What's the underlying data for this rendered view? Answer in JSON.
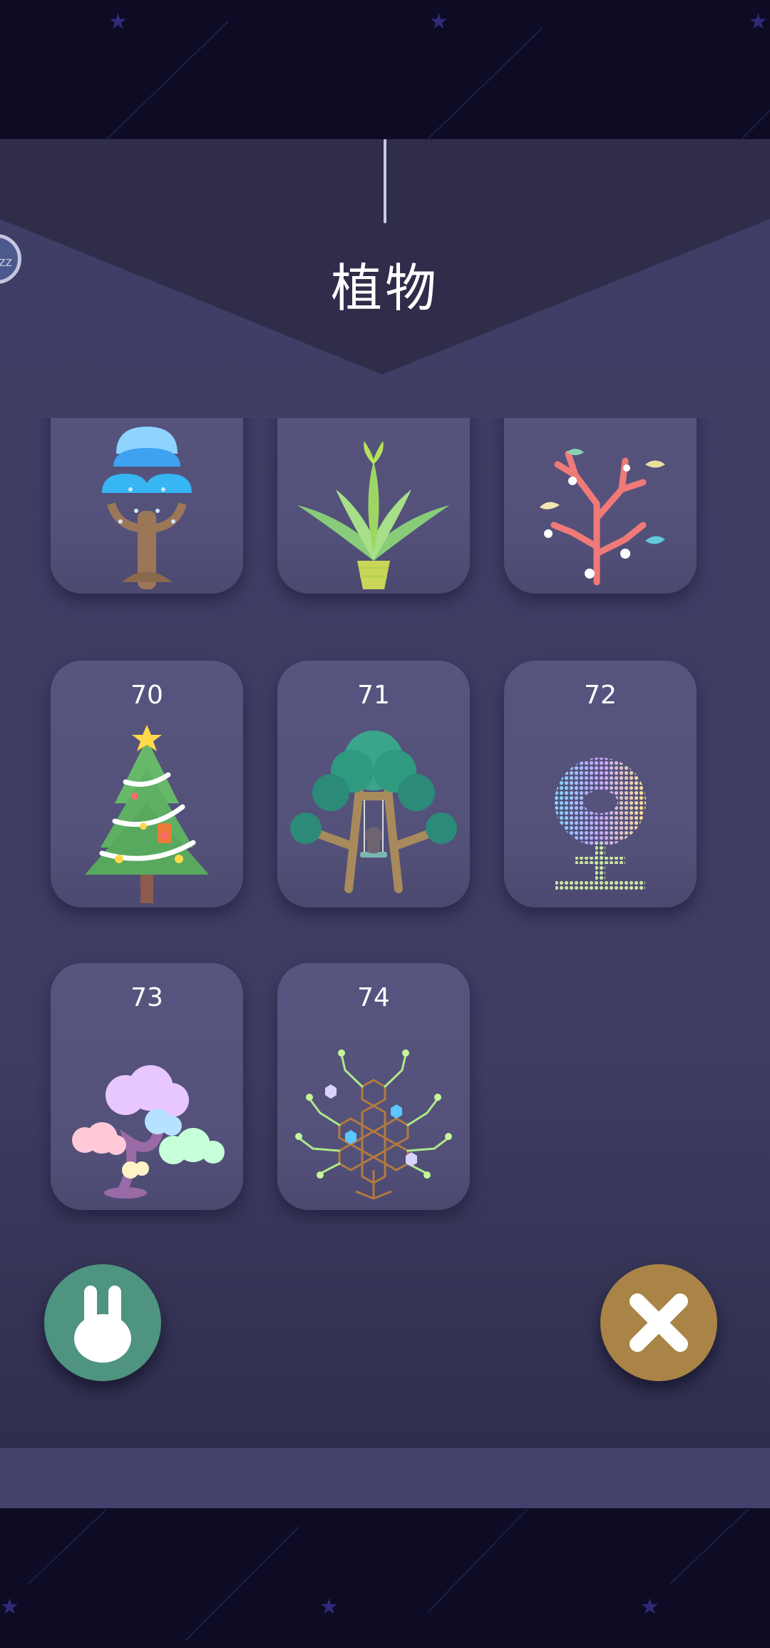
{
  "header": {
    "title": "植物"
  },
  "side_button": {
    "label": "zz"
  },
  "plants": [
    {
      "number": "",
      "name": "blue-mushroom-tree"
    },
    {
      "number": "",
      "name": "glowing-aloe"
    },
    {
      "number": "",
      "name": "coral-tree-with-fish"
    },
    {
      "number": "70",
      "name": "christmas-tree"
    },
    {
      "number": "71",
      "name": "swing-tree"
    },
    {
      "number": "72",
      "name": "pixel-flower"
    },
    {
      "number": "73",
      "name": "cloud-bonsai"
    },
    {
      "number": "74",
      "name": "honeycomb-tree"
    }
  ],
  "buttons": {
    "rabbit": {
      "icon": "rabbit-icon"
    },
    "close": {
      "icon": "close-icon"
    }
  },
  "colors": {
    "panel": "#3f3e66",
    "card": "#57557f",
    "rabbit_button": "#4e9480",
    "close_button": "#a98446",
    "night_sky": "#0d0c24"
  }
}
